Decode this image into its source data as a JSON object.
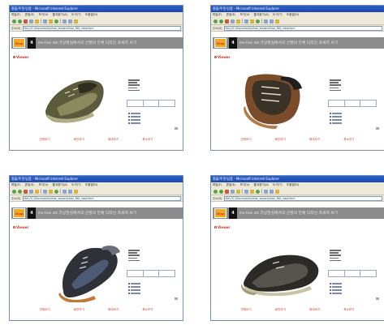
{
  "windows": [
    {
      "title": "환불/주문/상품 - Microsoft Internet Explorer",
      "menu": [
        "파일(F)",
        "편집(E)",
        "보기(V)",
        "즐겨찾기(A)",
        "도구(T)",
        "도움말(H)"
      ],
      "address_label": "주소(D)",
      "address": "file:///C:/Documents/shoe_viewer/shoe_360_view.html",
      "banner_logo": "Shop",
      "banner_number": "4",
      "banner_text": "On-line 3D 가상현실에서의 신발의 전체 디자인 자세히 보기",
      "section_label": "Viewer",
      "links": [
        "전체보기",
        "회전보기",
        "확대보기",
        "축소보기"
      ]
    },
    {
      "title": "환불/주문/상품 - Microsoft Internet Explorer",
      "menu": [
        "파일(F)",
        "편집(E)",
        "보기(V)",
        "즐겨찾기(A)",
        "도구(T)",
        "도움말(H)"
      ],
      "address_label": "주소(D)",
      "address": "file:///C:/Documents/shoe_viewer/shoe_360_view.html",
      "banner_logo": "Shop",
      "banner_number": "4",
      "banner_text": "On-line 3D 가상현실에서의 신발의 전체 디자인 자세히 보기",
      "section_label": "Viewer",
      "links": [
        "전체보기",
        "회전보기",
        "확대보기",
        "축소보기"
      ]
    },
    {
      "title": "환불/주문/상품 - Microsoft Internet Explorer",
      "menu": [
        "파일(F)",
        "편집(E)",
        "보기(V)",
        "즐겨찾기(A)",
        "도구(T)",
        "도움말(H)"
      ],
      "address_label": "주소(D)",
      "address": "file:///C:/Documents/shoe_viewer/shoe_360_view.html",
      "banner_logo": "Shop",
      "banner_number": "4",
      "banner_text": "On-line 3D 가상현실에서의 신발의 전체 디자인 자세히 보기",
      "section_label": "Viewer",
      "links": [
        "전체보기",
        "회전보기",
        "확대보기",
        "축소보기"
      ]
    },
    {
      "title": "환불/주문/상품 - Microsoft Internet Explorer",
      "menu": [
        "파일(F)",
        "편집(E)",
        "보기(V)",
        "즐겨찾기(A)",
        "도구(T)",
        "도움말(H)"
      ],
      "address_label": "주소(D)",
      "address": "file:///C:/Documents/shoe_viewer/shoe_360_view.html",
      "banner_logo": "Shop",
      "banner_number": "4",
      "banner_text": "On-line 3D 가상현실에서의 신발의 전체 디자인 자세히 보기",
      "section_label": "Viewer",
      "links": [
        "전체보기",
        "회전보기",
        "확대보기",
        "축소보기"
      ]
    }
  ],
  "colors": {
    "titlebar": "#1c49b0",
    "chrome": "#ece9d8",
    "banner": "#8c8c8c",
    "logo_bg": "#f5a623",
    "link_red": "#c0392b"
  },
  "icons": [
    "back-icon",
    "forward-icon",
    "stop-icon",
    "refresh-icon",
    "home-icon",
    "search-icon",
    "favorites-icon",
    "mail-icon",
    "print-icon"
  ]
}
